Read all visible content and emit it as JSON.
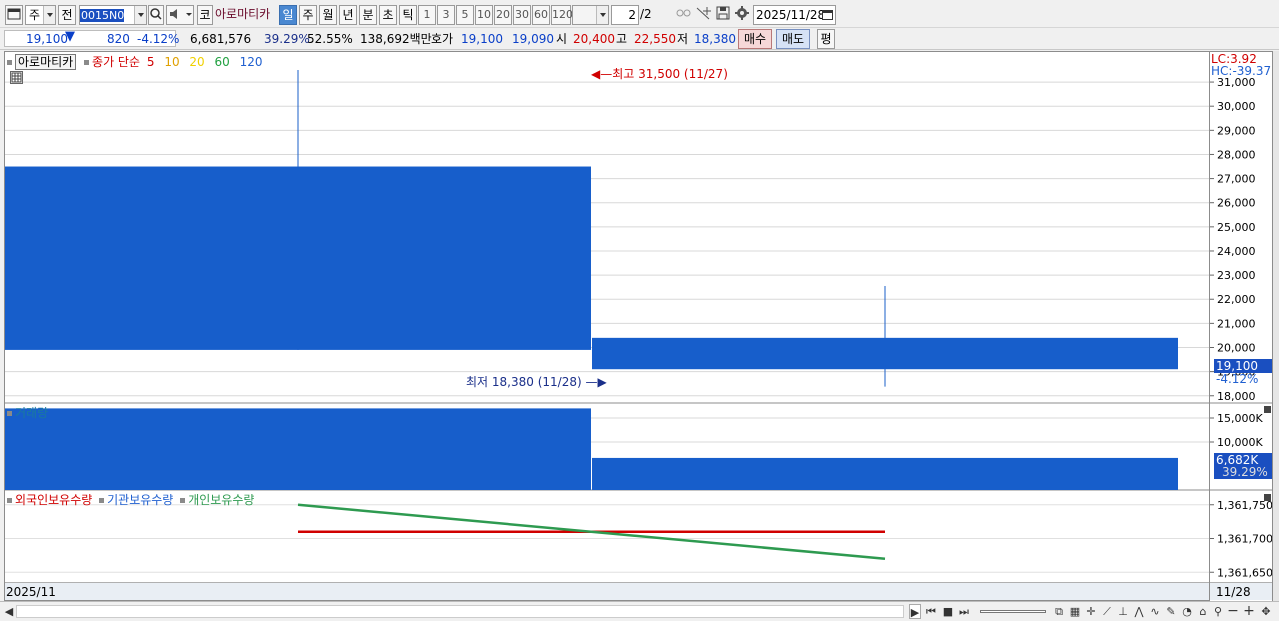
{
  "toolbar": {
    "period_unit": "주",
    "prev_label": "전",
    "code": "0015N0",
    "stock_name": "아로마티카",
    "code_btn": "코",
    "periods": [
      "일",
      "주",
      "월",
      "년",
      "분",
      "초",
      "틱"
    ],
    "selected_period": "일",
    "intervals": [
      "1",
      "3",
      "5",
      "10",
      "20",
      "30",
      "60",
      "120"
    ],
    "page": "2",
    "page_total": "/2",
    "date": "2025/11/28"
  },
  "quote": {
    "price": "19,100",
    "change": "820",
    "change_pct": "-4.12%",
    "volume": "6,681,576",
    "ratio1": "39.29%",
    "ratio2": "52.55%",
    "amount": "138,692백만",
    "bid_label": "호가",
    "bid1": "19,100",
    "bid2": "19,090",
    "open_label": "시",
    "open": "20,400",
    "high_label": "고",
    "high": "22,550",
    "low_label": "저",
    "low": "18,380",
    "buy_label": "매수",
    "sell_label": "매도",
    "avg_label": "평"
  },
  "price_panel": {
    "stock_name": "아로마티카",
    "ma_label": "종가 단순",
    "ma_periods": [
      "5",
      "10",
      "20",
      "60",
      "120"
    ],
    "ma_colors": [
      "#d00000",
      "#e0a000",
      "#f0d000",
      "#20a040",
      "#2060d0"
    ],
    "high_annotation": "최고 31,500 (11/27)",
    "low_annotation": "최저 18,380 (11/28)",
    "lc": "LC:3.92",
    "hc": "HC:-39.37",
    "last_price": "19,100",
    "last_pct": "-4.12%"
  },
  "volume_panel": {
    "label": "거래량",
    "last_volume": "6,682K",
    "last_pct": "39.29%"
  },
  "holdings_panel": {
    "legend": [
      "외국인보유수량",
      "기관보유수량",
      "개인보유수량"
    ],
    "legend_colors": [
      "#d00000",
      "#2060d0",
      "#2e9a50"
    ]
  },
  "footer": {
    "period": "2025/11",
    "last_date": "11/28"
  },
  "chart_data": [
    {
      "type": "candlestick",
      "title": "아로마티카",
      "x": [
        "11/27",
        "11/28"
      ],
      "open": [
        27500,
        20400
      ],
      "high": [
        31500,
        22550
      ],
      "low": [
        19900,
        18380
      ],
      "close": [
        19900,
        19100
      ],
      "yticks": [
        18000,
        19000,
        20000,
        21000,
        22000,
        23000,
        24000,
        25000,
        26000,
        27000,
        28000,
        29000,
        30000,
        31000
      ],
      "ylim": [
        17700,
        31500
      ]
    },
    {
      "type": "bar",
      "title": "거래량",
      "x": [
        "11/27",
        "11/28"
      ],
      "values": [
        17000000,
        6682000
      ],
      "yticks": [
        "10,000K",
        "15,000K"
      ],
      "ylim": [
        0,
        17500000
      ]
    },
    {
      "type": "line",
      "x": [
        "11/27",
        "11/28"
      ],
      "series": [
        {
          "name": "외국인보유수량",
          "values": [
            1361710,
            1361710
          ]
        },
        {
          "name": "개인보유수량",
          "values": [
            1361750,
            1361670
          ]
        }
      ],
      "yticks": [
        "1,361,650",
        "1,361,700",
        "1,361,750"
      ]
    }
  ]
}
